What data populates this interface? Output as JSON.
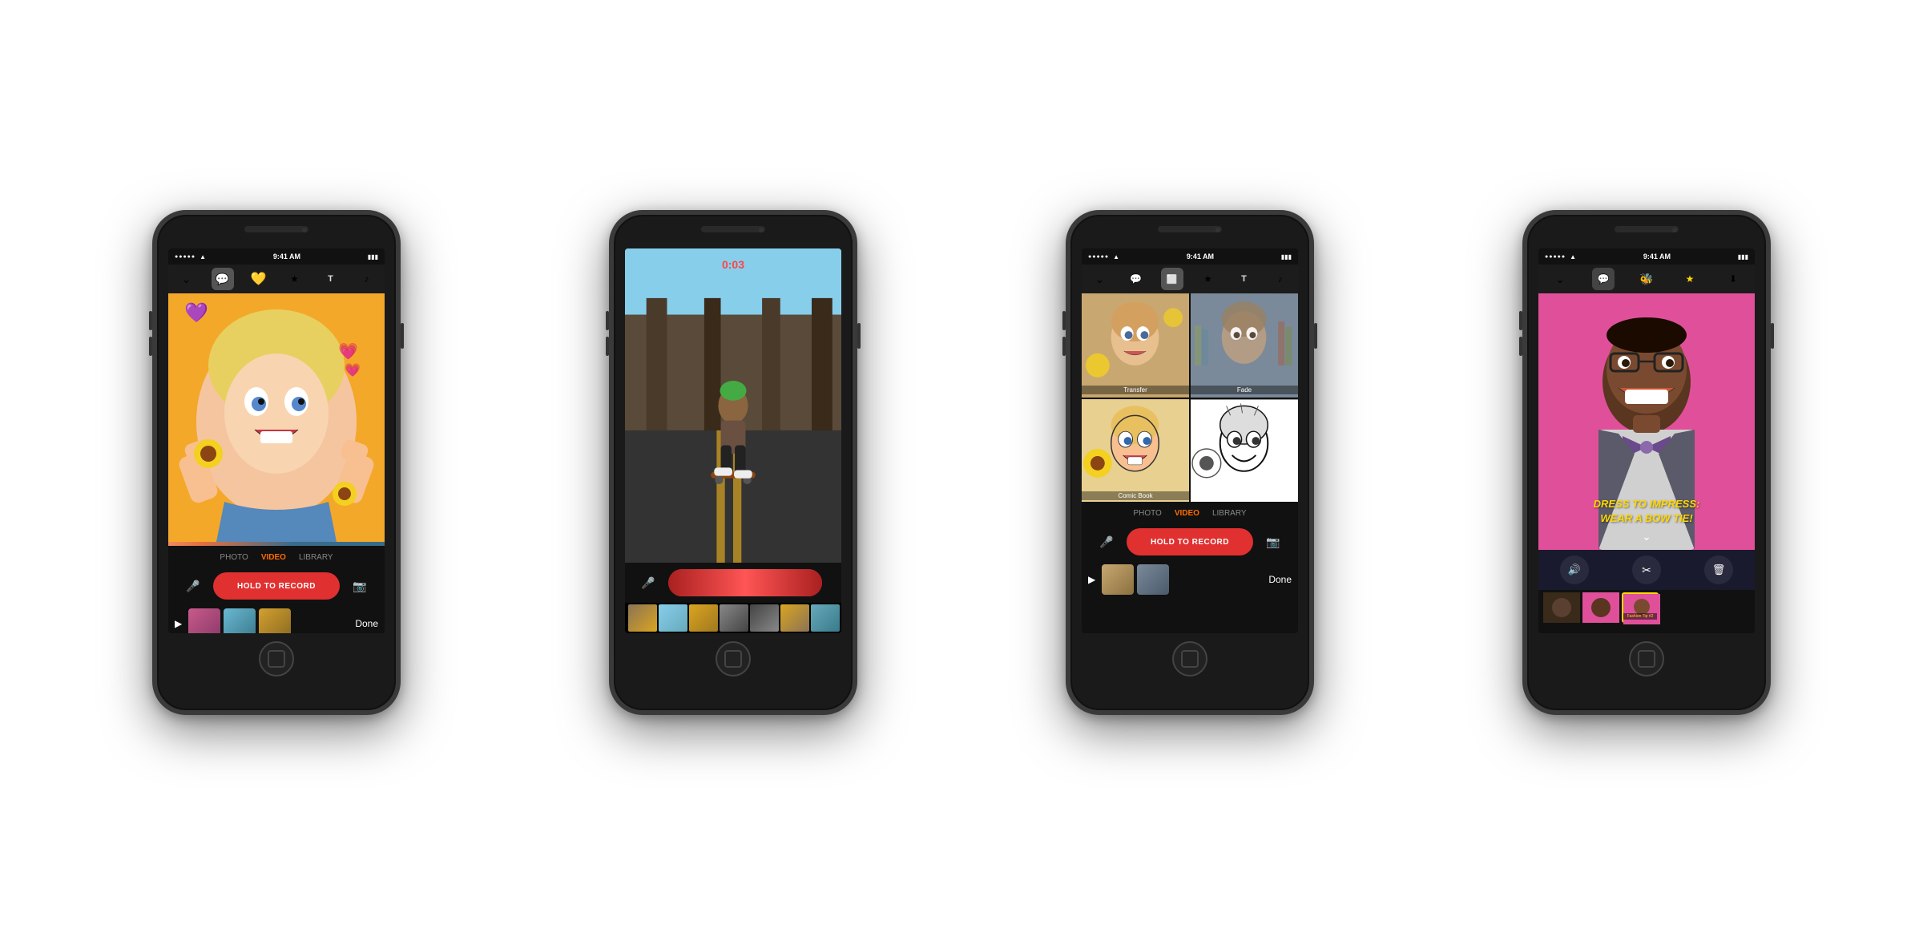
{
  "phones": [
    {
      "id": "phone1",
      "status": {
        "time": "9:41 AM",
        "signal": "●●●●●",
        "wifi": "WiFi",
        "battery": "Battery"
      },
      "toolbar": {
        "icons": [
          "chevron-down",
          "speech-bubble",
          "emoji",
          "star",
          "text",
          "music"
        ]
      },
      "mode": {
        "options": [
          "PHOTO",
          "VIDEO",
          "LIBRARY"
        ],
        "active": "VIDEO"
      },
      "record_button": "HOLD TO RECORD",
      "done_label": "Done",
      "hearts": "💜",
      "pink_hearts": "💗💗"
    },
    {
      "id": "phone2",
      "timer": "0:03",
      "status": {},
      "toolbar": {}
    },
    {
      "id": "phone3",
      "status": {
        "time": "9:41 AM"
      },
      "mode": {
        "options": [
          "PHOTO",
          "VIDEO",
          "LIBRARY"
        ],
        "active": "VIDEO"
      },
      "record_button": "HOLD TO RECORD",
      "done_label": "Done",
      "filter_labels": [
        "Transfer",
        "Fade",
        "Comic Book",
        ""
      ]
    },
    {
      "id": "phone4",
      "status": {
        "time": "9:41 AM"
      },
      "dress_text": "DRESS TO IMPRESS:\nWEAR A BOW TIE!",
      "film_label": "Fashion Tip #2"
    }
  ]
}
